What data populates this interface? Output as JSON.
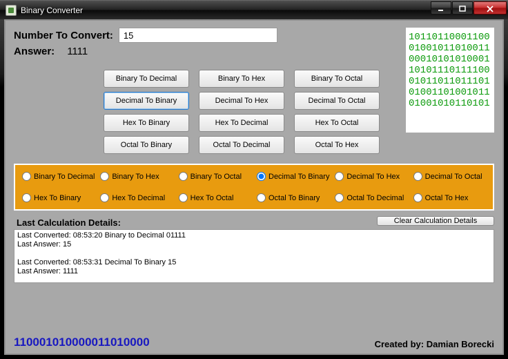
{
  "window": {
    "title": "Binary Converter"
  },
  "labels": {
    "number_to_convert": "Number To Convert:",
    "answer": "Answer:",
    "last_calc": "Last Calculation Details:"
  },
  "input": {
    "value": "15"
  },
  "answer": {
    "value": "1111"
  },
  "decor_lines": [
    "10110110001100",
    "01001011010011",
    "00010101010001",
    "10101110111100",
    "01011011011101",
    "01001101001011",
    "01001010110101"
  ],
  "buttons": {
    "grid": [
      "Binary To Decimal",
      "Binary To Hex",
      "Binary To Octal",
      "Decimal To Binary",
      "Decimal To Hex",
      "Decimal To Octal",
      "Hex To Binary",
      "Hex To Decimal",
      "Hex To Octal",
      "Octal To Binary",
      "Octal To Decimal",
      "Octal To Hex"
    ],
    "selected_index": 3,
    "clear": "Clear Calculation Details"
  },
  "radios": {
    "options": [
      "Binary To Decimal",
      "Binary To Hex",
      "Binary To Octal",
      "Decimal To Binary",
      "Decimal To Hex",
      "Decimal To Octal",
      "Hex To Binary",
      "Hex To Decimal",
      "Hex To Octal",
      "Octal To Binary",
      "Octal To Decimal",
      "Octal To Hex"
    ],
    "selected_index": 3
  },
  "log": {
    "lines": [
      "Last Converted: 08:53:20  Binary to Decimal 01111",
      "Last Answer: 15",
      "",
      "Last Converted: 08:53:31  Decimal To Binary 15",
      "Last Answer: 1111"
    ]
  },
  "footer": {
    "bignum": "110001010000011010000",
    "credit": "Created by: Damian Borecki"
  }
}
